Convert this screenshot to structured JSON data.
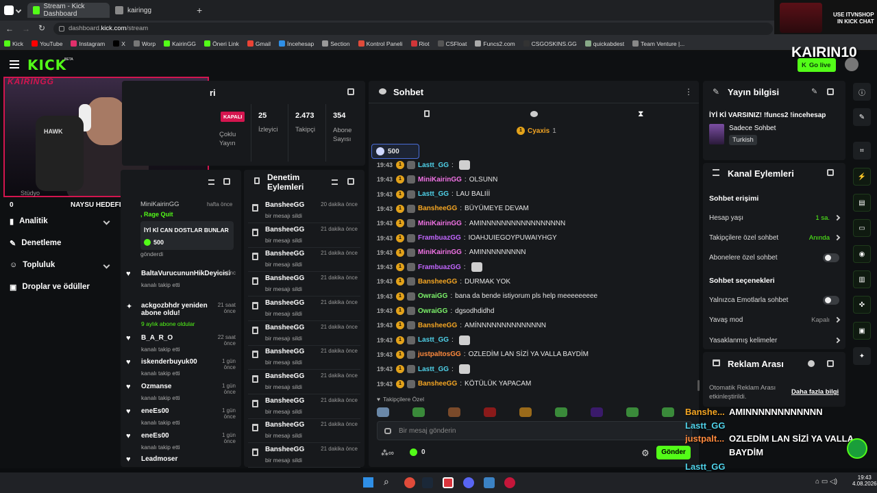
{
  "browser": {
    "tabs": [
      {
        "label": "Stream - Kick Dashboard",
        "active": true
      },
      {
        "label": "kairingg",
        "active": false
      }
    ],
    "url_prefix": "dashboard.",
    "url_domain": "kick.com",
    "url_path": "/stream",
    "bookmarks": [
      "Kick",
      "YouTube",
      "Instagram",
      "X",
      "Worp",
      "KairinGG",
      "Öneri Link",
      "Gmail",
      "İncehesap",
      "Section",
      "Kontrol Paneli",
      "Riot",
      "CSFloat",
      "Funcs2.com",
      "CSGOSKINS.GG",
      "quickabdest",
      "Team Venture |..."
    ]
  },
  "promo": {
    "line1": "USE ITVNSHOP",
    "line2": "IN KICK CHAT"
  },
  "header": {
    "logo": "KICK",
    "beta": "BETA",
    "channel_name": "KAIRIN10",
    "go_live": "Go live",
    "accent": "#53fc18"
  },
  "webcam": {
    "watermark": "KAIRINGG",
    "hawk": "HAWK"
  },
  "stream_info": {
    "title_frag": "ri",
    "status_badge": "KAPALI",
    "mode": "Çoklu Yayın",
    "viewers": "25",
    "viewers_label": "İzleyici",
    "followers": "2.473",
    "followers_label": "Takipçi",
    "subs": "354",
    "subs_label": "Abone Sayısı"
  },
  "goal_overlay": {
    "label": "NAYSU HEDEFLER",
    "left": "0",
    "right": "10",
    "partial": "Stüdyo"
  },
  "sidebar": {
    "items": [
      {
        "label": "Analitik",
        "icon": "chart-icon",
        "chevron": true
      },
      {
        "label": "Denetleme",
        "icon": "wrench-icon",
        "chevron": false
      },
      {
        "label": "Topluluk",
        "icon": "people-icon",
        "chevron": true
      },
      {
        "label": "Droplar ve ödüller",
        "icon": "gift-icon",
        "chevron": false
      }
    ]
  },
  "activity": {
    "top": {
      "name": "MiniKairinGG",
      "time": "hafta önce",
      "sub": ", Rage Quit",
      "message": "İYİ Kİ CAN DOSTLAR BUNLAR",
      "amount": "500",
      "tail": "gönderdi"
    },
    "items": [
      {
        "name": "BaltaVurucununHikDeyicisi",
        "sub": "kanalı takip etti",
        "time": "saa önc"
      },
      {
        "name": "ackgozbhdr yeniden abone oldu!",
        "sub": "9 aylık abone oldular",
        "time": "21 saat önce"
      },
      {
        "name": "B_A_R_O",
        "sub": "kanalı takip etti",
        "time": "22 saat önce"
      },
      {
        "name": "iskenderbuyuk00",
        "sub": "kanalı takip etti",
        "time": "1 gün önce"
      },
      {
        "name": "Ozmanse",
        "sub": "kanalı takip etti",
        "time": "1 gün önce"
      },
      {
        "name": "eneEs00",
        "sub": "kanalı takip etti",
        "time": "1 gün önce"
      },
      {
        "name": "eneEs00",
        "sub": "kanalı takip etti",
        "time": "1 gün önce"
      },
      {
        "name": "Leadmoser",
        "sub": "",
        "time": ""
      }
    ]
  },
  "moderation": {
    "title": "Denetim Eylemleri",
    "items": [
      {
        "name": "BansheeGG",
        "sub": "bir mesajı sildi",
        "time": "20 dakika önce"
      },
      {
        "name": "BansheeGG",
        "sub": "bir mesajı sildi",
        "time": "21 dakika önce"
      },
      {
        "name": "BansheeGG",
        "sub": "bir mesajı sildi",
        "time": "21 dakika önce"
      },
      {
        "name": "BansheeGG",
        "sub": "bir mesajı sildi",
        "time": "21 dakika önce"
      },
      {
        "name": "BansheeGG",
        "sub": "bir mesajı sildi",
        "time": "21 dakika önce"
      },
      {
        "name": "BansheeGG",
        "sub": "bir mesajı sildi",
        "time": "21 dakika önce"
      },
      {
        "name": "BansheeGG",
        "sub": "bir mesajı sildi",
        "time": "21 dakika önce"
      },
      {
        "name": "BansheeGG",
        "sub": "bir mesajı sildi",
        "time": "21 dakika önce"
      },
      {
        "name": "BansheeGG",
        "sub": "bir mesajı sildi",
        "time": "21 dakika önce"
      },
      {
        "name": "BansheeGG",
        "sub": "bir mesajı sildi",
        "time": "21 dakika önce"
      },
      {
        "name": "BansheeGG",
        "sub": "bir mesajı sildi",
        "time": "21 dakika önce"
      }
    ]
  },
  "chat": {
    "title": "Sohbet",
    "pinned_user": "Cyaxis",
    "pinned_count": "1",
    "gift_amount": "500",
    "messages": [
      {
        "time": "19:43",
        "user": "Lastt_GG",
        "color": "#4fd1e8",
        "text": "",
        "emote": true
      },
      {
        "time": "19:43",
        "user": "MiniKairinGG",
        "color": "#f273e6",
        "text": "OLSUNN"
      },
      {
        "time": "19:43",
        "user": "Lastt_GG",
        "color": "#4fd1e8",
        "text": "LAU BALIİİ"
      },
      {
        "time": "19:43",
        "user": "BansheeGG",
        "color": "#f5a623",
        "text": "BÜYÜMEYE DEVAM"
      },
      {
        "time": "19:43",
        "user": "MiniKairinGG",
        "color": "#f273e6",
        "text": "AMINNNNNNNNNNNNNNNNN"
      },
      {
        "time": "19:43",
        "user": "FrambuazGG",
        "color": "#c266ff",
        "text": "IOAHJUIEGOYPUWAIYHGY"
      },
      {
        "time": "19:43",
        "user": "MiniKairinGG",
        "color": "#f273e6",
        "text": "AMINNNNNNNNN"
      },
      {
        "time": "19:43",
        "user": "FrambuazGG",
        "color": "#c266ff",
        "text": "",
        "emote": true
      },
      {
        "time": "19:43",
        "user": "BansheeGG",
        "color": "#f5a623",
        "text": "DURMAK YOK"
      },
      {
        "time": "19:43",
        "user": "OwraiGG",
        "color": "#7cf26a",
        "text": "bana da bende istiyorum pls help meeeeeeeee"
      },
      {
        "time": "19:43",
        "user": "OwraiGG",
        "color": "#7cf26a",
        "text": "dgsodhdidhd"
      },
      {
        "time": "19:43",
        "user": "BansheeGG",
        "color": "#f5a623",
        "text": "AMİNNNNNNNNNNNNNN"
      },
      {
        "time": "19:43",
        "user": "Lastt_GG",
        "color": "#4fd1e8",
        "text": "",
        "emote": true
      },
      {
        "time": "19:43",
        "user": "justpaltosGG",
        "color": "#ff8a3d",
        "text": "OZLEDİM LAN SİZİ YA VALLA BAYDİM"
      },
      {
        "time": "19:43",
        "user": "Lastt_GG",
        "color": "#4fd1e8",
        "text": "",
        "emote": true
      },
      {
        "time": "19:43",
        "user": "BansheeGG",
        "color": "#f5a623",
        "text": "KÖTÜLÜK YAPACAM"
      }
    ],
    "followers_only": "Takipçilere Özel",
    "input_placeholder": "Bir mesaj gönderin",
    "points": "0",
    "send": "Gönder"
  },
  "stream_panel": {
    "title": "Yayın bilgisi",
    "stream_title": "İYİ Kİ VARSINIZ! !funcs2 !incehesap",
    "category": "Sadece Sohbet",
    "language": "Turkish"
  },
  "channel_actions": {
    "title": "Kanal Eylemleri",
    "chat_access": "Sohbet erişimi",
    "account_age": {
      "label": "Hesap yaşı",
      "value": "1 sa."
    },
    "followers_only": {
      "label": "Takipçilere özel sohbet",
      "value": "Anında"
    },
    "subs_only": {
      "label": "Abonelere özel sohbet"
    },
    "chat_options": "Sohbet seçenekleri",
    "emote_only": {
      "label": "Yalnızca Emotlarla sohbet"
    },
    "slow_mode": {
      "label": "Yavaş mod",
      "value": "Kapalı"
    },
    "banned_words": {
      "label": "Yasaklanmış kelimeler"
    }
  },
  "ad_break": {
    "title": "Reklam Arası",
    "text": "Otomatik Reklam Arası etkinleştirildi.",
    "link": "Daha fazla bilgi"
  },
  "overlay_chat": [
    {
      "user": "Banshe...",
      "text": "AMINNNNNNNNNNNN",
      "color": "#f5a623"
    },
    {
      "user": "Lastt_GG",
      "text": "",
      "color": "#4fd1e8"
    },
    {
      "user": "justpalt...",
      "text": "OZLEDİM LAN SİZİ YA VALLA",
      "color": "#ff8a3d"
    },
    {
      "user": "",
      "text": "BAYDİM",
      "color": "#ffffff"
    },
    {
      "user": "Lastt_GG",
      "text": "",
      "color": "#4fd1e8"
    },
    {
      "user": "Banshe...",
      "text": "KÖTÜLÜK YAPACAM",
      "color": "#f5a623"
    }
  ],
  "taskbar": {
    "time": "19:43",
    "date": "4.08.2026"
  }
}
